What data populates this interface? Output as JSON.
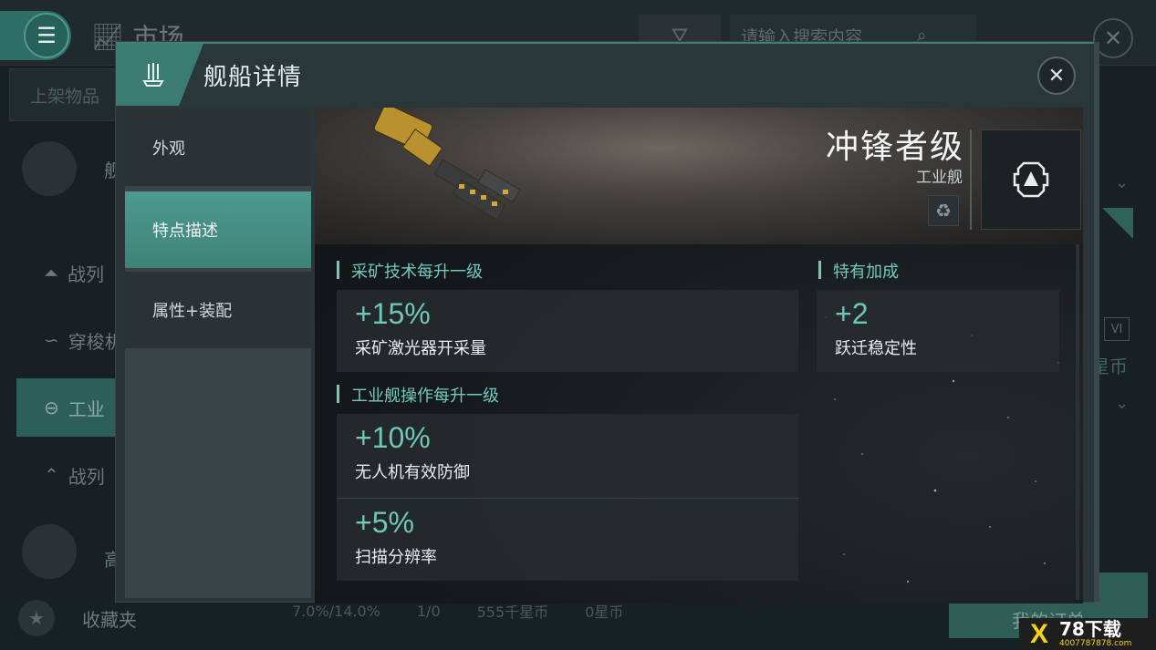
{
  "background": {
    "screen_title": "市场",
    "search_placeholder": "请输入搜索内容",
    "sidebar_tab": "上架物品",
    "sidebar_items": [
      "舰",
      "战列",
      "穿梭机",
      "工业",
      "战列",
      "高"
    ],
    "favorites_label": "收藏夹",
    "stats": [
      "7.0%/14.0%",
      "1/0",
      "555千星币",
      "0星币"
    ],
    "my_orders_label": "我的订单",
    "side_badge": "VI",
    "side_currency": "星币"
  },
  "modal": {
    "title": "舰船详情",
    "nav": [
      {
        "label": "外观",
        "active": false
      },
      {
        "label": "特点描述",
        "active": true
      },
      {
        "label": "属性+装配",
        "active": false
      }
    ],
    "ship": {
      "name": "冲锋者级",
      "class": "工业舰"
    },
    "sections": [
      {
        "title": "采矿技术每升一级",
        "bonuses": [
          {
            "value": "+15%",
            "desc": "采矿激光器开采量"
          }
        ]
      },
      {
        "title": "特有加成",
        "bonuses": [
          {
            "value": "+2",
            "desc": "跃迁稳定性"
          }
        ]
      },
      {
        "title": "工业舰操作每升一级",
        "bonuses": [
          {
            "value": "+10%",
            "desc": "无人机有效防御"
          },
          {
            "value": "+5%",
            "desc": "扫描分辨率"
          }
        ]
      }
    ]
  },
  "watermark": {
    "brand": "78下载",
    "url": "4007787878.com",
    "mark": "X"
  },
  "icons": {
    "menu": "menu-icon",
    "chart": "chart-icon",
    "filter": "filter-icon",
    "search": "search-icon",
    "close": "close-icon",
    "ship_header": "ship-icon",
    "recycle": "recycle-icon",
    "emblem": "industrial-emblem-icon",
    "star": "star-icon"
  },
  "colors": {
    "accent": "#4d9a8f",
    "bonus_value": "#6fc7b9",
    "section_title": "#72c9bd"
  }
}
